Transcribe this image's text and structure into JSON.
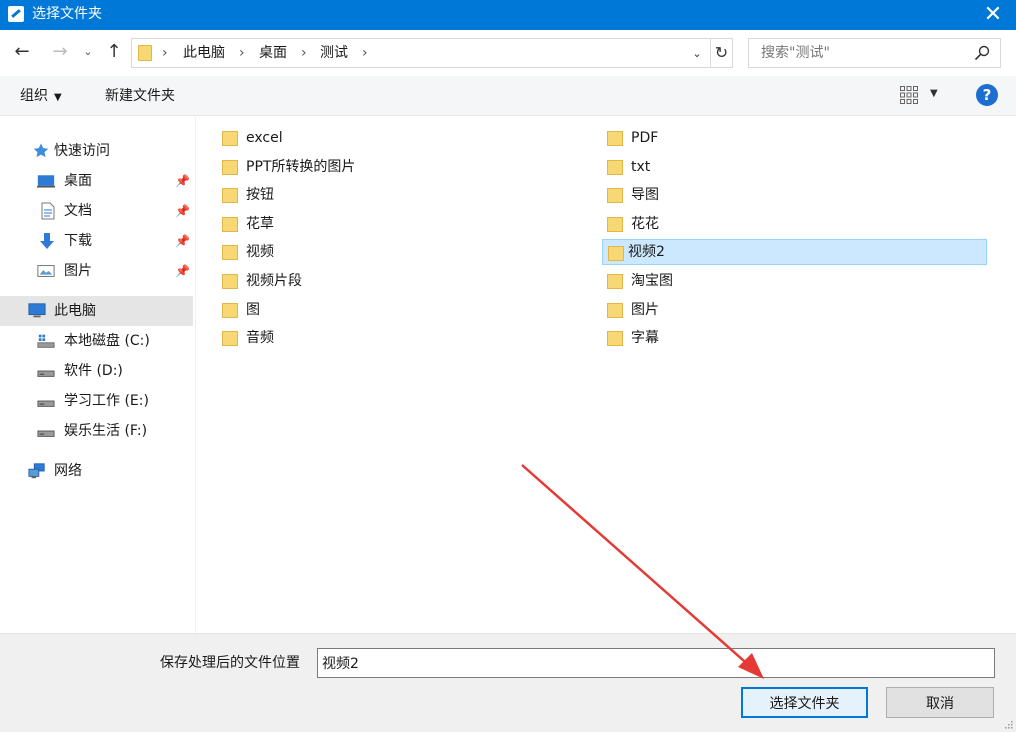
{
  "window": {
    "title": "选择文件夹",
    "close_label": "✕"
  },
  "nav_buttons": {
    "back": "←",
    "forward": "→",
    "recent": "⌄",
    "up": "↑"
  },
  "breadcrumb": {
    "items": [
      "此电脑",
      "桌面",
      "测试"
    ],
    "separator": "›",
    "dropdown": "⌄",
    "refresh": "↻"
  },
  "search": {
    "placeholder": "搜索\"测试\""
  },
  "commandbar": {
    "organize": "组织",
    "organize_caret": "▼",
    "new_folder": "新建文件夹",
    "view_caret": "▼",
    "help": "?"
  },
  "sidebar": {
    "pin": "📌",
    "items": [
      {
        "label": "快速访问",
        "icon": "star-icon"
      },
      {
        "label": "桌面",
        "icon": "desktop-icon",
        "pinned": true
      },
      {
        "label": "文档",
        "icon": "document-icon",
        "pinned": true
      },
      {
        "label": "下载",
        "icon": "download-icon",
        "pinned": true
      },
      {
        "label": "图片",
        "icon": "pictures-icon",
        "pinned": true
      },
      {
        "label": "此电脑",
        "icon": "computer-icon",
        "selected": true
      },
      {
        "label": "本地磁盘 (C:)",
        "icon": "windows-drive-icon"
      },
      {
        "label": "软件 (D:)",
        "icon": "drive-icon"
      },
      {
        "label": "学习工作 (E:)",
        "icon": "drive-icon"
      },
      {
        "label": "娱乐生活 (F:)",
        "icon": "drive-icon"
      },
      {
        "label": "网络",
        "icon": "network-icon"
      }
    ]
  },
  "folders": {
    "left": [
      "excel",
      "PPT所转换的图片",
      "按钮",
      "花草",
      "视频",
      "视频片段",
      "图",
      "音频"
    ],
    "right": [
      "PDF",
      "txt",
      "导图",
      "花花",
      "视频2",
      "淘宝图",
      "图片",
      "字幕"
    ],
    "selected": "视频2"
  },
  "footer": {
    "folder_label": "保存处理后的文件位置",
    "folder_value": "视频2",
    "select_button": "选择文件夹",
    "cancel_button": "取消"
  },
  "colors": {
    "titlebar": "#0078d7",
    "selection": "#cce8ff",
    "folder": "#f8d775",
    "annotation_arrow": "#e53935"
  }
}
